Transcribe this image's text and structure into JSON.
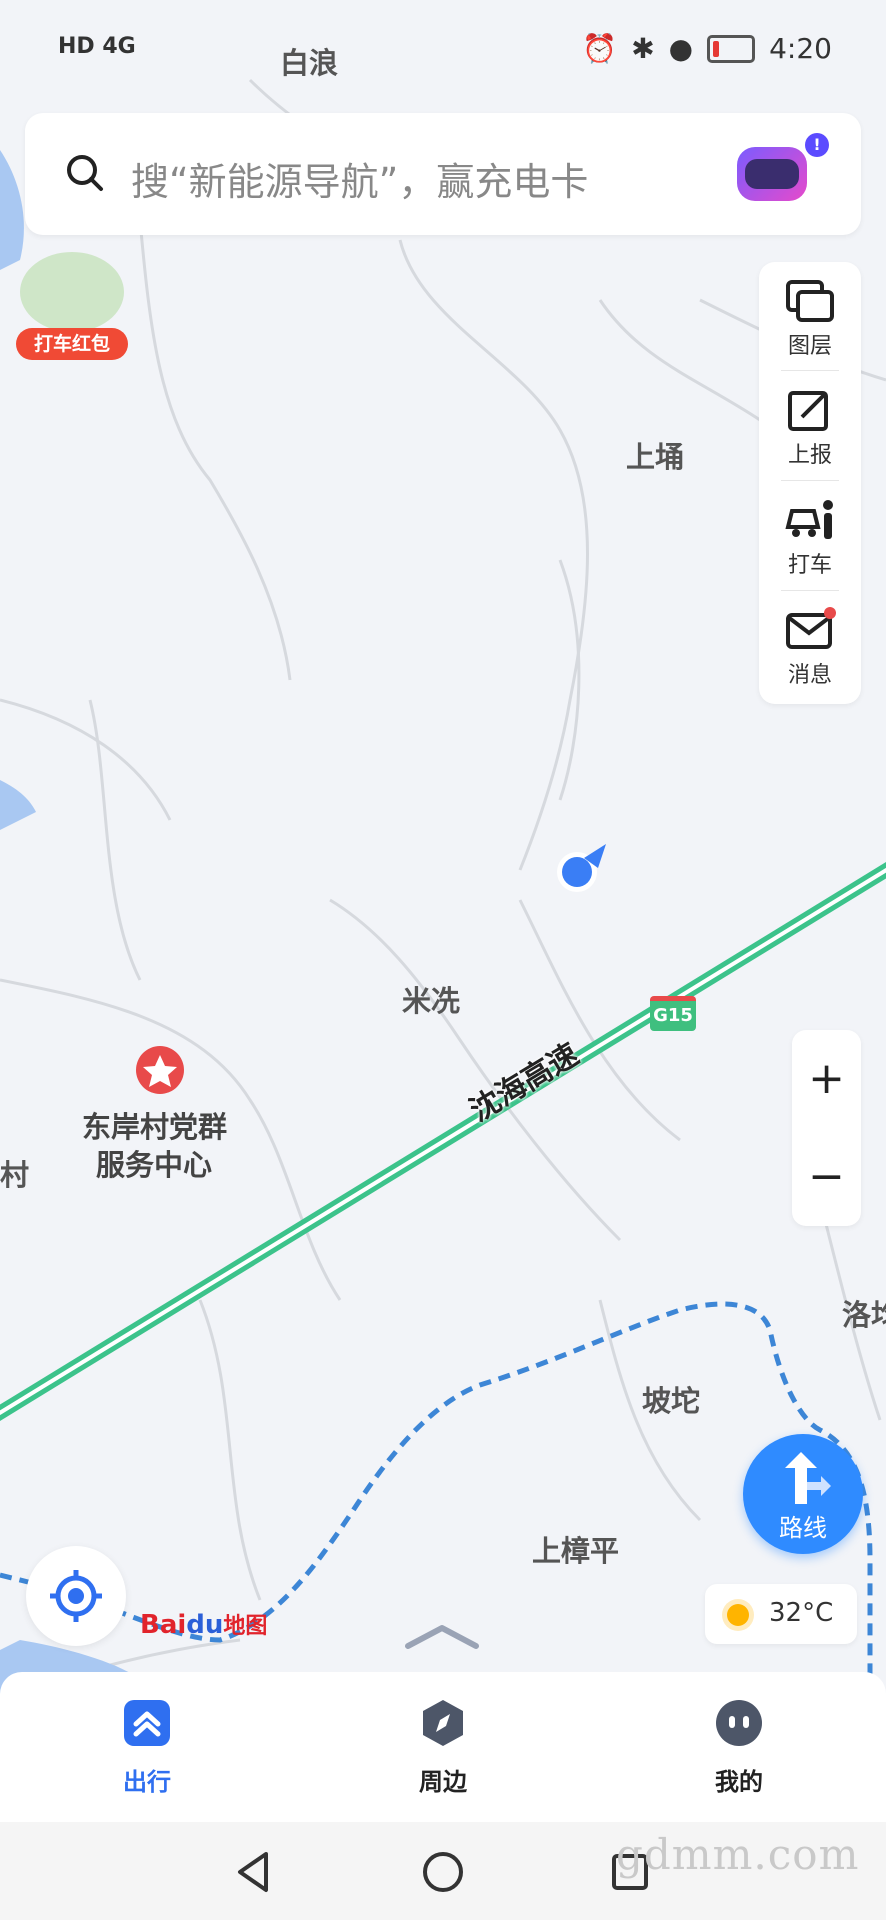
{
  "status_bar": {
    "network": "HD 4G",
    "time": "4:20"
  },
  "search": {
    "placeholder": "搜“新能源导航”，赢充电卡"
  },
  "promo": {
    "label": "打车红包"
  },
  "side_panel": {
    "items": [
      {
        "label": "图层",
        "icon": "layers-icon"
      },
      {
        "label": "上报",
        "icon": "report-edit-icon"
      },
      {
        "label": "打车",
        "icon": "taxi-icon"
      },
      {
        "label": "消息",
        "icon": "mail-icon"
      }
    ]
  },
  "map": {
    "places": [
      "白浪",
      "上埇",
      "米冼",
      "东岸村党群",
      "服务中心",
      "坡坨",
      "上樟平",
      "洛均",
      "村"
    ],
    "highway": {
      "name": "沈海高速",
      "shield": "G15",
      "color": "#3cc38b"
    },
    "accent": "#2f6ff0"
  },
  "zoom": {
    "in": "+",
    "out": "−"
  },
  "route": {
    "label": "路线"
  },
  "weather": {
    "temp": "32°C"
  },
  "logo": {
    "bai": "Bai",
    "du": "du",
    "map": "地图"
  },
  "tabs": [
    {
      "label": "出行",
      "active": true
    },
    {
      "label": "周边",
      "active": false
    },
    {
      "label": "我的",
      "active": false
    }
  ],
  "watermark": "gdmm.com"
}
